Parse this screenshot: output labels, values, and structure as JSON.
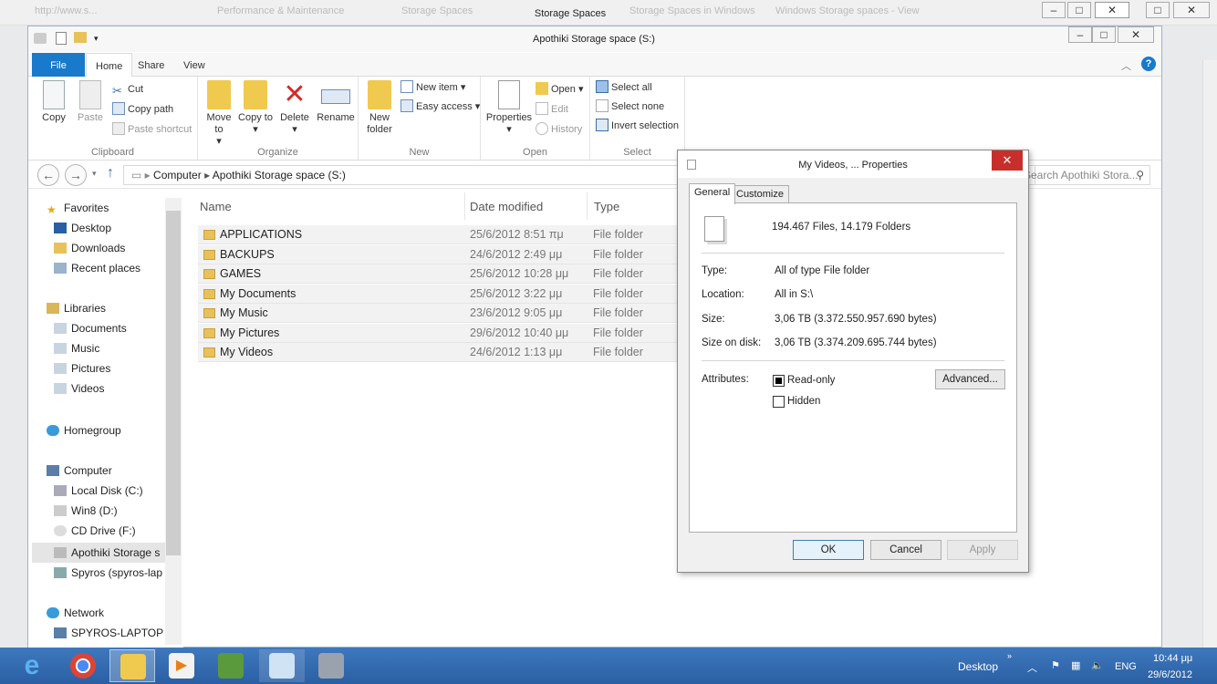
{
  "background_window": {
    "title": "Storage Spaces",
    "tabs": [
      "http://www.s...",
      "Performance & Maintenance",
      "Storage Spaces",
      "Storage Spaces in Windows",
      "Windows Storage spaces - View"
    ]
  },
  "explorer": {
    "title": "Apothiki Storage space (S:)",
    "tabs": {
      "file": "File",
      "home": "Home",
      "share": "Share",
      "view": "View"
    },
    "ribbon": {
      "clipboard": {
        "label": "Clipboard",
        "copy": "Copy",
        "paste": "Paste",
        "cut": "Cut",
        "copy_path": "Copy path",
        "paste_shortcut": "Paste shortcut"
      },
      "organize": {
        "label": "Organize",
        "move_to": "Move to",
        "copy_to": "Copy to",
        "delete": "Delete",
        "rename": "Rename"
      },
      "new": {
        "label": "New",
        "new_folder": "New folder",
        "new_item": "New item",
        "easy_access": "Easy access"
      },
      "open": {
        "label": "Open",
        "properties": "Properties",
        "open": "Open",
        "edit": "Edit",
        "history": "History"
      },
      "select": {
        "label": "Select",
        "select_all": "Select all",
        "select_none": "Select none",
        "invert": "Invert selection"
      }
    },
    "address": {
      "computer": "Computer",
      "drive": "Apothiki Storage space (S:)",
      "search_placeholder": "Search Apothiki Stora..."
    },
    "nav": {
      "favorites": "Favorites",
      "desktop": "Desktop",
      "downloads": "Downloads",
      "recent": "Recent places",
      "libraries": "Libraries",
      "documents": "Documents",
      "music": "Music",
      "pictures": "Pictures",
      "videos": "Videos",
      "homegroup": "Homegroup",
      "computer": "Computer",
      "local_disk": "Local Disk (C:)",
      "win8": "Win8 (D:)",
      "cd_drive": "CD Drive (F:)",
      "apothiki": "Apothiki Storage s",
      "spyros": "Spyros (spyros-lap",
      "network": "Network",
      "spyros_laptop": "SPYROS-LAPTOP"
    },
    "columns": {
      "name": "Name",
      "date": "Date modified",
      "type": "Type"
    },
    "files": [
      {
        "name": "APPLICATIONS",
        "date": "25/6/2012 8:51 πμ",
        "type": "File folder"
      },
      {
        "name": "BACKUPS",
        "date": "24/6/2012 2:49 μμ",
        "type": "File folder"
      },
      {
        "name": "GAMES",
        "date": "25/6/2012 10:28 μμ",
        "type": "File folder"
      },
      {
        "name": "My Documents",
        "date": "25/6/2012 3:22 μμ",
        "type": "File folder"
      },
      {
        "name": "My Music",
        "date": "23/6/2012 9:05 μμ",
        "type": "File folder"
      },
      {
        "name": "My Pictures",
        "date": "29/6/2012 10:40 μμ",
        "type": "File folder"
      },
      {
        "name": "My Videos",
        "date": "24/6/2012 1:13 μμ",
        "type": "File folder"
      }
    ]
  },
  "properties": {
    "title": "My Videos, ... Properties",
    "tabs": {
      "general": "General",
      "customize": "Customize"
    },
    "summary": "194.467 Files, 14.179 Folders",
    "type_label": "Type:",
    "type_value": "All of type File folder",
    "location_label": "Location:",
    "location_value": "All in S:\\",
    "size_label": "Size:",
    "size_value": "3,06 TB (3.372.550.957.690 bytes)",
    "size_disk_label": "Size on disk:",
    "size_disk_value": "3,06 TB (3.374.209.695.744 bytes)",
    "attributes_label": "Attributes:",
    "readonly": "Read-only",
    "hidden": "Hidden",
    "advanced": "Advanced...",
    "ok": "OK",
    "cancel": "Cancel",
    "apply": "Apply"
  },
  "taskbar": {
    "desktop": "Desktop",
    "lang": "ENG",
    "time": "10:44 μμ",
    "date": "29/6/2012"
  },
  "colors": {
    "accent": "#1979ca",
    "taskbar": "#2f68ad",
    "close": "#c7302a"
  }
}
